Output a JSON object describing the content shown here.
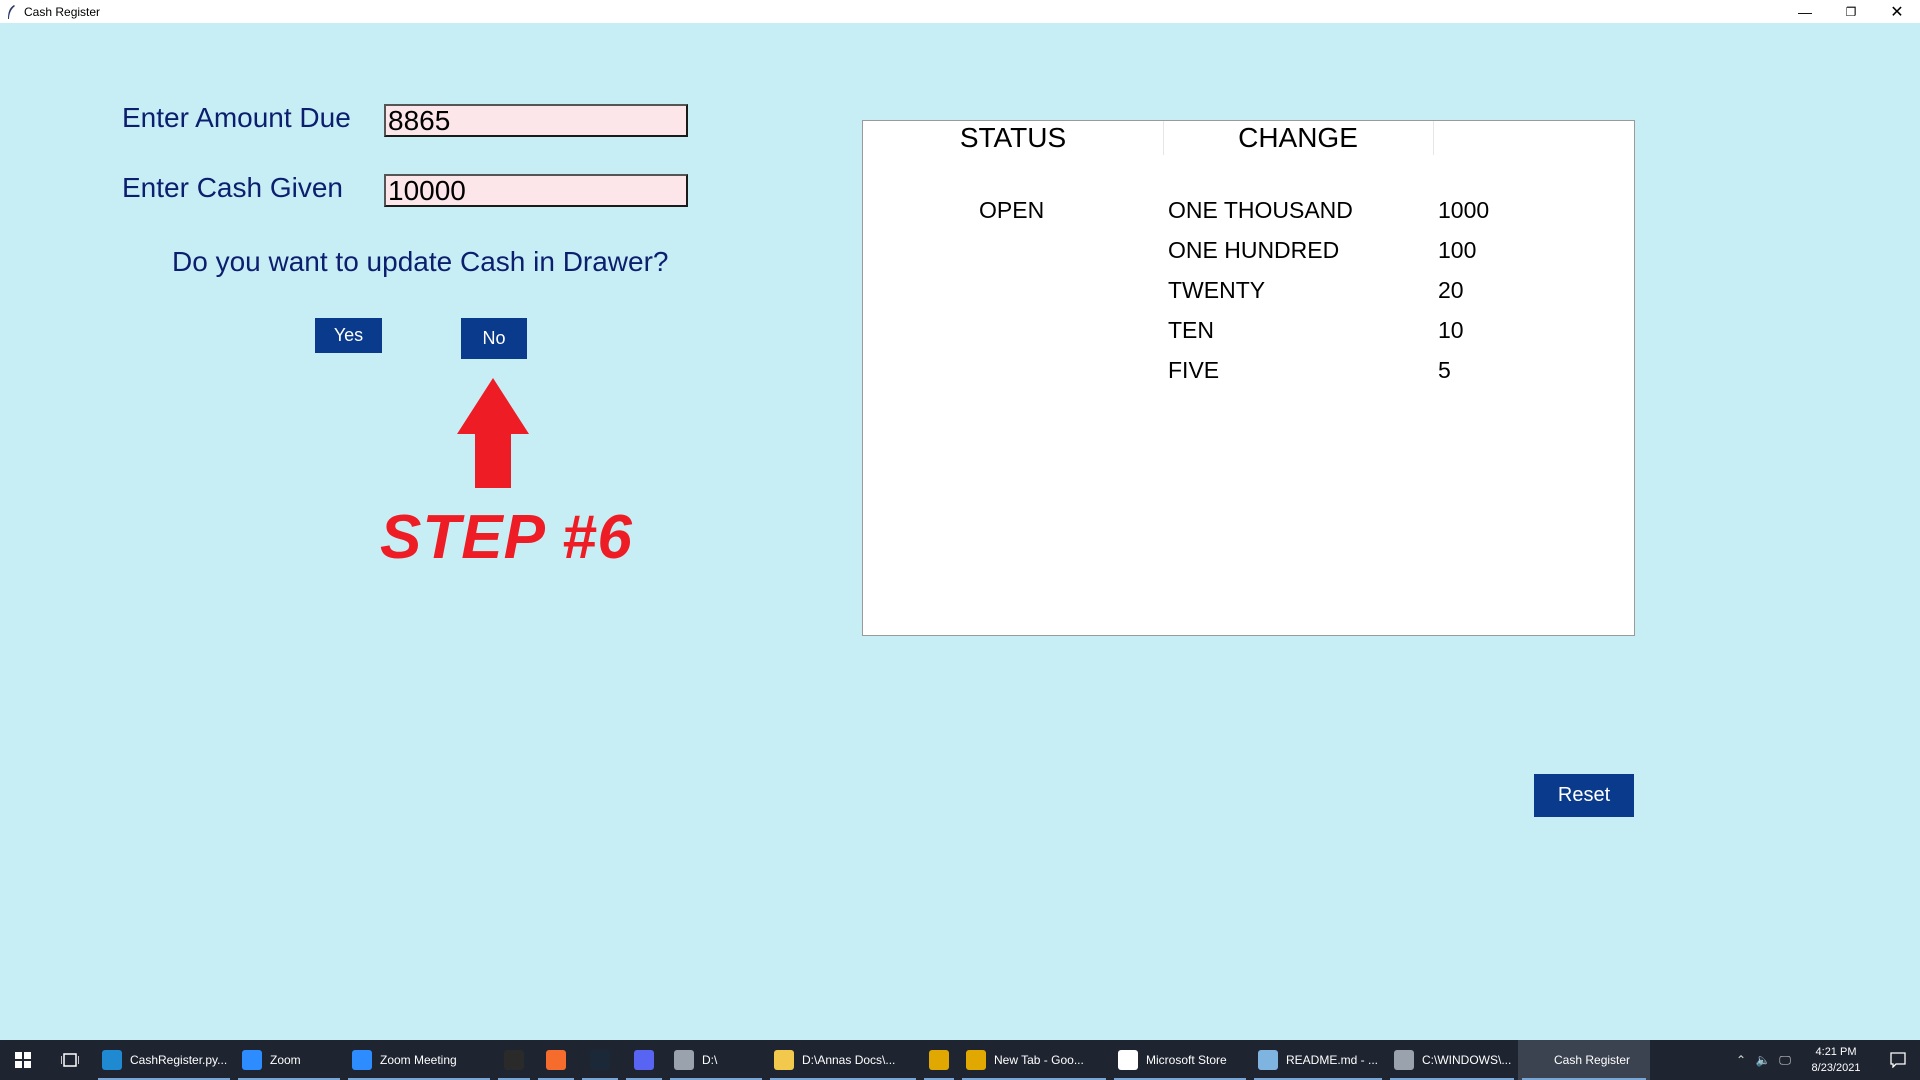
{
  "window": {
    "title": "Cash Register",
    "minimize_glyph": "—",
    "maximize_glyph": "❐",
    "close_glyph": "✕"
  },
  "form": {
    "amount_due_label": "Enter Amount Due",
    "amount_due_value": "8865",
    "cash_given_label": "Enter Cash Given",
    "cash_given_value": "10000",
    "question": "Do you want to update Cash in Drawer?",
    "yes_label": "Yes",
    "no_label": "No"
  },
  "annotation": {
    "step_text": "STEP #6",
    "arrow_color": "#ee1c25"
  },
  "panel": {
    "status_header": "STATUS",
    "change_header": "CHANGE",
    "status_value": "OPEN",
    "change_rows": [
      {
        "name": "ONE THOUSAND",
        "amount": "1000"
      },
      {
        "name": "ONE HUNDRED",
        "amount": "100"
      },
      {
        "name": "TWENTY",
        "amount": "20"
      },
      {
        "name": "TEN",
        "amount": "10"
      },
      {
        "name": "FIVE",
        "amount": "5"
      }
    ]
  },
  "reset_label": "Reset",
  "colors": {
    "background": "#c8eef5",
    "button": "#0a3a8c",
    "label_text": "#0c1e6e",
    "entry_bg": "#fde6ea"
  },
  "taskbar": {
    "items": [
      {
        "label": "CashRegister.py...",
        "icon": "vscode-icon",
        "color": "#1f8ad2"
      },
      {
        "label": "Zoom",
        "icon": "zoom-icon",
        "color": "#2d8cff"
      },
      {
        "label": "Zoom Meeting",
        "icon": "zoom-meeting-icon",
        "color": "#2d8cff"
      },
      {
        "label": "",
        "icon": "epic-games-icon",
        "color": "#2a2a2a"
      },
      {
        "label": "",
        "icon": "origin-icon",
        "color": "#f56c2d"
      },
      {
        "label": "",
        "icon": "steam-icon",
        "color": "#1b2838"
      },
      {
        "label": "",
        "icon": "discord-icon",
        "color": "#5865f2"
      },
      {
        "label": "D:\\",
        "icon": "drive-icon",
        "color": "#9aa3ad"
      },
      {
        "label": "D:\\Annas Docs\\...",
        "icon": "folder-icon",
        "color": "#f2c94c"
      },
      {
        "label": "",
        "icon": "chrome-icon",
        "color": "#e0a800"
      },
      {
        "label": "New Tab - Goo...",
        "icon": "chrome-tab-icon",
        "color": "#e0a800"
      },
      {
        "label": "Microsoft Store",
        "icon": "store-icon",
        "color": "#ffffff"
      },
      {
        "label": "README.md - ...",
        "icon": "notepad-icon",
        "color": "#7fb3e0"
      },
      {
        "label": "C:\\WINDOWS\\...",
        "icon": "cmd-icon",
        "color": "#9aa3ad"
      },
      {
        "label": "Cash Register",
        "icon": "feather-icon",
        "color": "#3b4250"
      }
    ],
    "time": "4:21 PM",
    "date": "8/23/2021"
  }
}
